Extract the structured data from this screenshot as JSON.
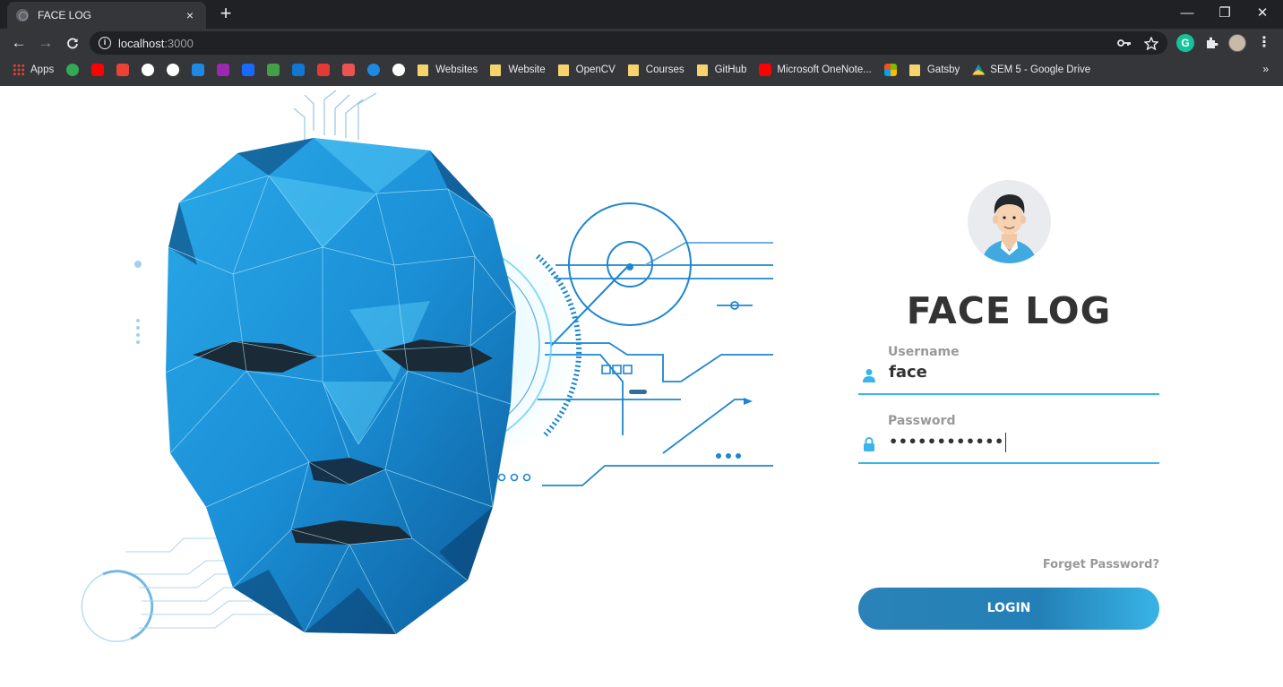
{
  "browser": {
    "tab_title": "FACE LOG",
    "tab_close": "×",
    "new_tab": "+",
    "window_controls": {
      "minimize": "—",
      "restore": "❐",
      "close": "✕"
    },
    "nav": {
      "back": "←",
      "forward": "→",
      "reload": "C"
    },
    "url_host": "localhost",
    "url_port": ":3000",
    "omnibox_icons": [
      "key-icon",
      "star-icon"
    ],
    "extensions": [
      "grammarly-icon",
      "puzzle-icon",
      "profile-avatar",
      "more-icon"
    ],
    "bookmarks": [
      {
        "label": "Apps",
        "icon": "apps-grid-icon"
      },
      {
        "label": "",
        "icon": "maps-icon",
        "color": "#34a853"
      },
      {
        "label": "",
        "icon": "youtube-icon",
        "color": "#ff0000"
      },
      {
        "label": "",
        "icon": "gmail-icon",
        "color": "#ea4335"
      },
      {
        "label": "",
        "icon": "google-icon",
        "color": "#ffffff"
      },
      {
        "label": "",
        "icon": "github-icon",
        "color": "#ffffff"
      },
      {
        "label": "",
        "icon": "bot-icon",
        "color": "#1e88e5"
      },
      {
        "label": "",
        "icon": "p-icon",
        "color": "#9c27b0"
      },
      {
        "label": "",
        "icon": "behance-icon",
        "color": "#1769ff"
      },
      {
        "label": "",
        "icon": "cg-icon",
        "color": "#43a047"
      },
      {
        "label": "",
        "icon": "onedrive-icon",
        "color": "#0f78d4"
      },
      {
        "label": "",
        "icon": "box-icon",
        "color": "#e53935"
      },
      {
        "label": "",
        "icon": "udemy-icon",
        "color": "#ec5252"
      },
      {
        "label": "",
        "icon": "play-icon",
        "color": "#1e88e5"
      },
      {
        "label": "",
        "icon": "globe-icon",
        "color": "#ffffff"
      },
      {
        "label": "Websites",
        "icon": "folder-icon"
      },
      {
        "label": "Website",
        "icon": "folder-icon"
      },
      {
        "label": "OpenCV",
        "icon": "folder-icon"
      },
      {
        "label": "Courses",
        "icon": "folder-icon"
      },
      {
        "label": "GitHub",
        "icon": "folder-icon"
      },
      {
        "label": "Microsoft OneNote...",
        "icon": "youtube-icon",
        "color": "#ff0000"
      },
      {
        "label": "",
        "icon": "microsoft-icon"
      },
      {
        "label": "Gatsby",
        "icon": "folder-icon"
      },
      {
        "label": "SEM 5 - Google Drive",
        "icon": "drive-icon"
      }
    ],
    "bookmarks_more": "»"
  },
  "login": {
    "title": "FACE LOG",
    "username_label": "Username",
    "username_value": "face",
    "password_label": "Password",
    "password_value": "••••••••••••",
    "forgot_label": "Forget Password?",
    "login_label": "LOGIN",
    "accent_color": "#38b6e8",
    "button_color": "#2380b6"
  }
}
